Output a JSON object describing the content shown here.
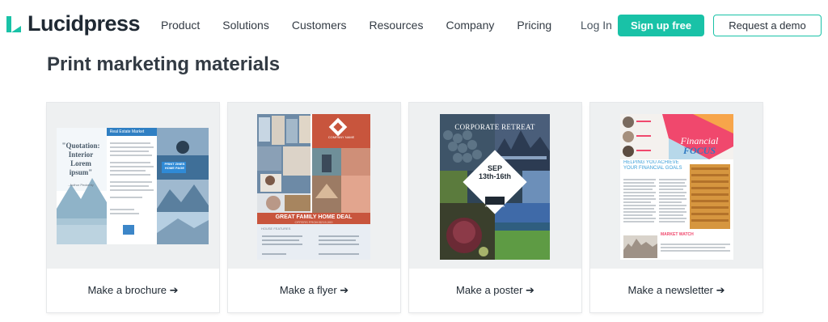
{
  "brand": {
    "name": "Lucidpress",
    "accent": "#19c2a7"
  },
  "nav": {
    "items": [
      "Product",
      "Solutions",
      "Customers",
      "Resources",
      "Company",
      "Pricing"
    ],
    "login": "Log In",
    "signup": "Sign up free",
    "demo": "Request a demo"
  },
  "page": {
    "title": "Print marketing materials"
  },
  "cards": [
    {
      "label": "Make a brochure ➔"
    },
    {
      "label": "Make a flyer ➔"
    },
    {
      "label": "Make a poster ➔"
    },
    {
      "label": "Make a newsletter ➔"
    }
  ],
  "thumbs": {
    "brochure": {
      "header": "Real Estate Market",
      "quote": "\"Quotation: Interior Lorem ipsum\"",
      "author": "- Author Peckerity",
      "print": "PRINT ZINES HOME PAGE"
    },
    "flyer": {
      "company": "COMPANY NAME",
      "headline": "GREAT FAMILY HOME DEAL",
      "sub": "OFFERS FROM $215,000",
      "features": "HOUSE FEATURES"
    },
    "poster": {
      "title": "CORPORATE RETREAT",
      "date": "SEP 13th-16th",
      "company": "COMPANY NAME"
    },
    "newsletter": {
      "title1": "Financial",
      "title2": "FOCUS",
      "heading": "HELPING YOU ACHIEVE YOUR FINANCIAL GOALS",
      "market": "MARKET WATCH"
    }
  }
}
